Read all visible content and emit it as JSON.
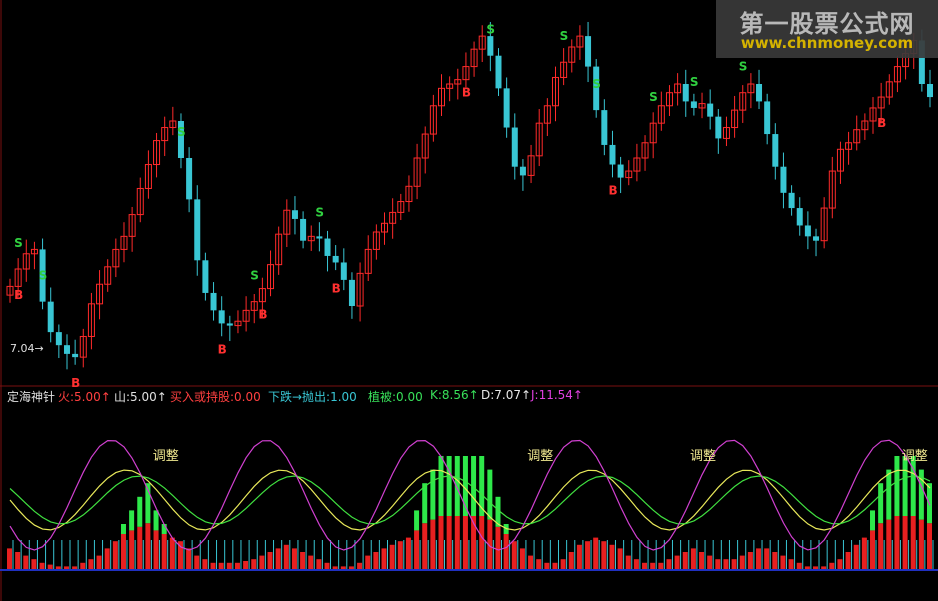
{
  "watermark": {
    "title": "第一股票公式网",
    "url": "www.chnmoney.com"
  },
  "chart_data": {
    "type": "candlestick",
    "indicator": {
      "name": "定海神针",
      "fire": "火:5.00↑",
      "mountain": "山:5.00↑",
      "buy_hold": "买入或持股:0.00",
      "sell": "下跌→抛出:1.00",
      "veg": "植被:0.00",
      "k": "K:8.56↑",
      "d": "D:7.07↑",
      "j": "J:11.54↑"
    },
    "price_label": "7.04→",
    "adjust_label": "调整",
    "buy_label": "B",
    "sell_label": "S",
    "colors": {
      "up": "#ff2a2a",
      "down": "#39c6d4",
      "buy": "#ff3030",
      "sell": "#30d040",
      "volume_up": "#e82020",
      "volume_green": "#2ee84a",
      "k": "#e8e85a",
      "d": "#40e040",
      "j": "#d040d0"
    },
    "main_series": [
      10.3,
      11.1,
      11.8,
      12.0,
      9.6,
      8.2,
      7.6,
      7.2,
      7.05,
      8.0,
      9.5,
      10.4,
      11.2,
      12.0,
      12.6,
      13.6,
      14.8,
      15.9,
      17.0,
      17.6,
      17.9,
      16.2,
      14.3,
      11.5,
      10.0,
      9.2,
      8.6,
      8.5,
      8.7,
      9.2,
      9.6,
      10.2,
      11.3,
      12.7,
      13.8,
      13.4,
      12.4,
      12.6,
      12.5,
      11.7,
      11.4,
      10.6,
      9.4,
      10.9,
      12.0,
      12.8,
      13.2,
      13.7,
      14.2,
      14.9,
      16.2,
      17.3,
      18.6,
      19.4,
      19.6,
      19.8,
      20.4,
      21.2,
      21.8,
      20.9,
      19.4,
      17.6,
      15.8,
      15.4,
      16.3,
      17.8,
      18.6,
      19.9,
      20.6,
      21.3,
      21.8,
      20.4,
      18.4,
      16.8,
      15.9,
      15.3,
      15.6,
      16.2,
      16.9,
      17.8,
      18.6,
      19.2,
      19.6,
      18.8,
      18.5,
      18.7,
      18.1,
      17.1,
      17.6,
      18.4,
      19.2,
      19.6,
      18.8,
      17.3,
      15.8,
      14.6,
      13.9,
      13.1,
      12.6,
      12.4,
      13.9,
      15.6,
      16.6,
      16.9,
      17.5,
      17.9,
      18.5,
      19.0,
      19.7,
      20.4,
      21.0,
      21.6,
      19.6,
      19.0
    ],
    "buy_signals": [
      1,
      8,
      26,
      31,
      40,
      56,
      74,
      107
    ],
    "sell_signals": [
      1,
      4,
      21,
      30,
      38,
      59,
      68,
      72,
      79,
      84,
      90
    ],
    "adjust_positions": [
      19,
      65,
      85,
      111
    ],
    "volume_heights": [
      12,
      10,
      8,
      6,
      4,
      3,
      2,
      2,
      2,
      4,
      6,
      8,
      12,
      16,
      20,
      22,
      24,
      26,
      22,
      20,
      18,
      16,
      12,
      8,
      6,
      4,
      4,
      4,
      4,
      5,
      6,
      8,
      10,
      12,
      14,
      12,
      10,
      8,
      6,
      4,
      2,
      2,
      2,
      4,
      8,
      10,
      12,
      14,
      16,
      18,
      22,
      26,
      28,
      30,
      30,
      30,
      30,
      30,
      30,
      28,
      24,
      20,
      16,
      12,
      8,
      6,
      4,
      4,
      6,
      10,
      14,
      16,
      18,
      16,
      14,
      12,
      8,
      6,
      4,
      4,
      4,
      6,
      8,
      10,
      12,
      10,
      8,
      6,
      6,
      6,
      8,
      10,
      12,
      12,
      10,
      8,
      6,
      4,
      2,
      2,
      2,
      4,
      6,
      10,
      14,
      18,
      22,
      26,
      28,
      30,
      30,
      30,
      28,
      26
    ]
  }
}
